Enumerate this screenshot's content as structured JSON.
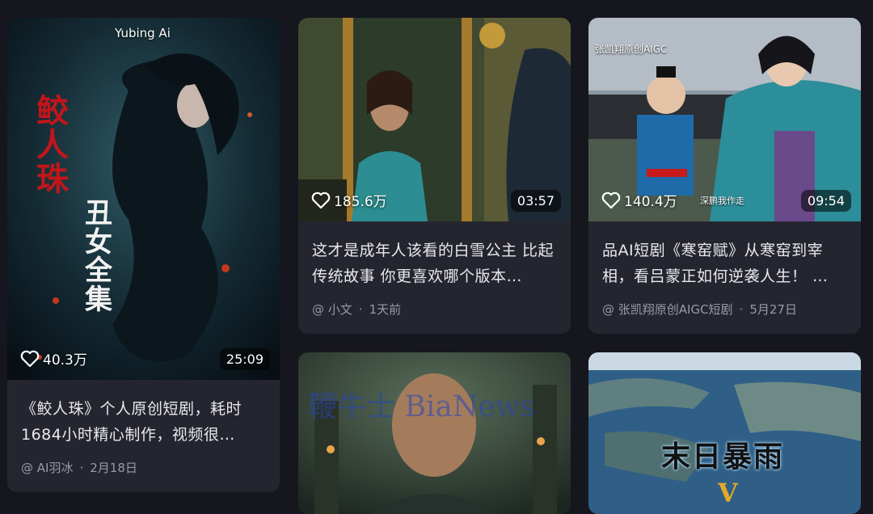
{
  "cards": [
    {
      "watermark": "Yubing Ai",
      "poster_text_red": "鲛人珠",
      "poster_text_white": "丑女全集",
      "likes": "40.3万",
      "duration": "25:09",
      "title": "《鲛人珠》个人原创短剧，耗时1684小时精心制作，视频很…",
      "author": "@ AI羽冰",
      "date": "2月18日"
    },
    {
      "likes": "185.6万",
      "duration": "03:57",
      "title": "这才是成年人该看的白雪公主 比起传统故事 你更喜欢哪个版本…",
      "author": "@ 小文",
      "date": "1天前"
    },
    {
      "watermark": "张凯翔原创AIGC",
      "likes": "140.4万",
      "overlay_note": "深鹏我作走",
      "duration": "09:54",
      "title": "品AI短剧《寒窑赋》从寒窑到宰相，看吕蒙正如何逆袭人生！ …",
      "author": "@ 张凯翔原创AIGC短剧",
      "date": "5月27日"
    },
    {
      "watermark": "鞭牛士 BiaNews"
    },
    {
      "poster_text": "末日暴雨",
      "poster_sub": "V"
    }
  ],
  "colors": {
    "background": "#16161e",
    "card": "#25252f",
    "title": "#e8e8ee",
    "meta": "#9a9aa6",
    "poster_red": "#c0161b"
  },
  "icons": [
    "heart-outline-icon"
  ]
}
